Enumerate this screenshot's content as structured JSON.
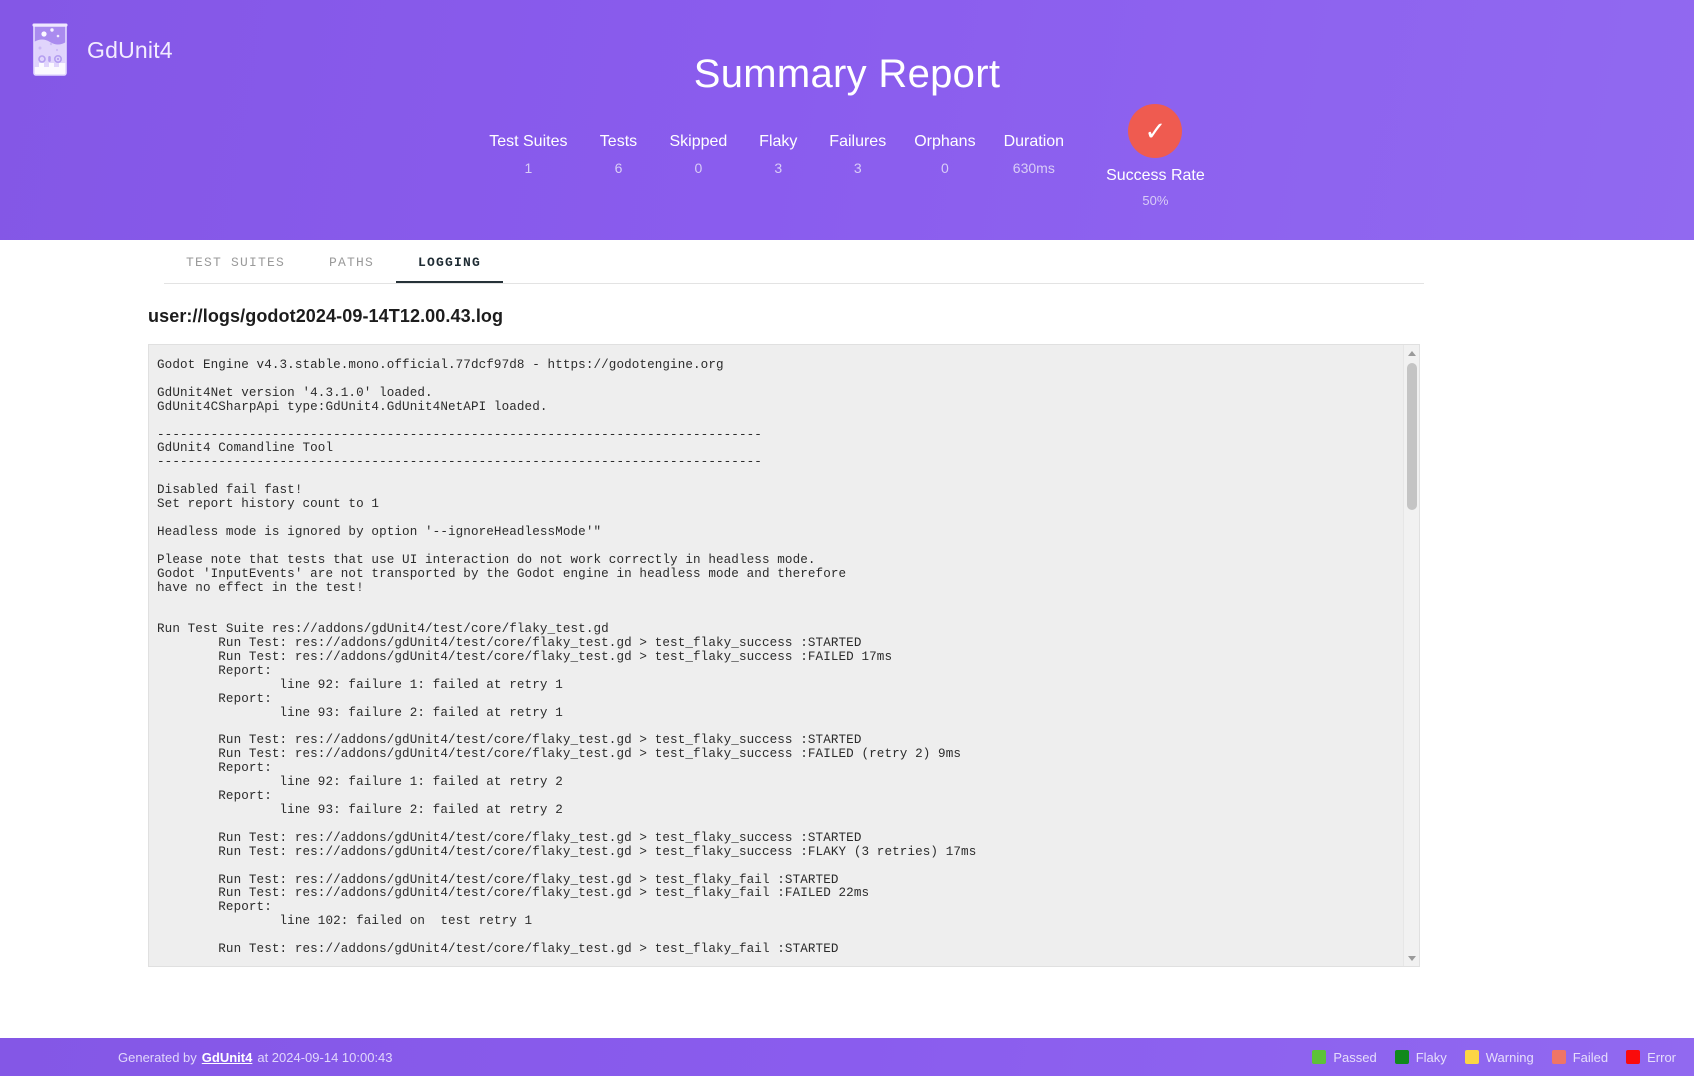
{
  "header": {
    "brand": "GdUnit4",
    "logo_icon": "beaker-icon",
    "title": "Summary Report",
    "stats": [
      {
        "label": "Test Suites",
        "value": "1"
      },
      {
        "label": "Tests",
        "value": "6"
      },
      {
        "label": "Skipped",
        "value": "0"
      },
      {
        "label": "Flaky",
        "value": "3"
      },
      {
        "label": "Failures",
        "value": "3"
      },
      {
        "label": "Orphans",
        "value": "0"
      },
      {
        "label": "Duration",
        "value": "630ms"
      }
    ],
    "success": {
      "icon": "check-icon",
      "glyph": "✓",
      "label": "Success Rate",
      "value": "50%",
      "color": "#ef5b50"
    }
  },
  "tabs": [
    {
      "label": "TEST SUITES",
      "active": false
    },
    {
      "label": "PATHS",
      "active": false
    },
    {
      "label": "LOGGING",
      "active": true
    }
  ],
  "logging": {
    "file_title": "user://logs/godot2024-09-14T12.00.43.log",
    "content": "Godot Engine v4.3.stable.mono.official.77dcf97d8 - https://godotengine.org\n\nGdUnit4Net version '4.3.1.0' loaded.\nGdUnit4CSharpApi type:GdUnit4.GdUnit4NetAPI loaded.\n\n-------------------------------------------------------------------------------\nGdUnit4 Comandline Tool\n-------------------------------------------------------------------------------\n\nDisabled fail fast!\nSet report history count to 1\n\nHeadless mode is ignored by option '--ignoreHeadlessMode'\"\n\nPlease note that tests that use UI interaction do not work correctly in headless mode.\nGodot 'InputEvents' are not transported by the Godot engine in headless mode and therefore\nhave no effect in the test!\n\n\nRun Test Suite res://addons/gdUnit4/test/core/flaky_test.gd\n        Run Test: res://addons/gdUnit4/test/core/flaky_test.gd > test_flaky_success :STARTED\n        Run Test: res://addons/gdUnit4/test/core/flaky_test.gd > test_flaky_success :FAILED 17ms\n        Report:\n                line 92: failure 1: failed at retry 1\n        Report:\n                line 93: failure 2: failed at retry 1\n\n        Run Test: res://addons/gdUnit4/test/core/flaky_test.gd > test_flaky_success :STARTED\n        Run Test: res://addons/gdUnit4/test/core/flaky_test.gd > test_flaky_success :FAILED (retry 2) 9ms\n        Report:\n                line 92: failure 1: failed at retry 2\n        Report:\n                line 93: failure 2: failed at retry 2\n\n        Run Test: res://addons/gdUnit4/test/core/flaky_test.gd > test_flaky_success :STARTED\n        Run Test: res://addons/gdUnit4/test/core/flaky_test.gd > test_flaky_success :FLAKY (3 retries) 17ms\n\n        Run Test: res://addons/gdUnit4/test/core/flaky_test.gd > test_flaky_fail :STARTED\n        Run Test: res://addons/gdUnit4/test/core/flaky_test.gd > test_flaky_fail :FAILED 22ms\n        Report:\n                line 102: failed on  test retry 1\n\n        Run Test: res://addons/gdUnit4/test/core/flaky_test.gd > test_flaky_fail :STARTED"
  },
  "footer": {
    "generated_prefix": "Generated by",
    "link": "GdUnit4",
    "generated_suffix": "at 2024-09-14 10:00:43",
    "legend": [
      {
        "label": "Passed",
        "color": "#5dc238"
      },
      {
        "label": "Flaky",
        "color": "#10891b"
      },
      {
        "label": "Warning",
        "color": "#fcd645"
      },
      {
        "label": "Failed",
        "color": "#ef7566"
      },
      {
        "label": "Error",
        "color": "#fa0b0b"
      }
    ]
  }
}
